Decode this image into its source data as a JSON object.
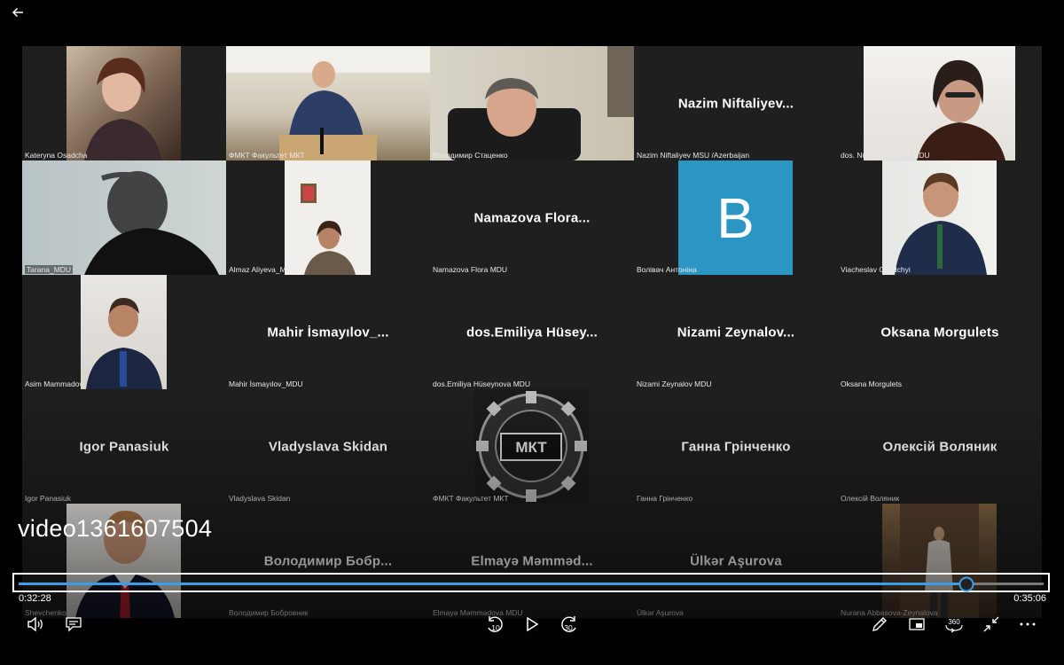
{
  "video": {
    "title": "video1361607504",
    "current_time": "0:32:28",
    "duration": "0:35:06",
    "progress_fraction": 0.925
  },
  "colors": {
    "accent": "#3a9ee8",
    "avatar_bg": "#2b95c4"
  },
  "icons": {
    "back": "arrow-left-icon",
    "volume": "volume-icon",
    "captions": "captions-icon",
    "skip_back": "skip-back-10-icon",
    "play": "play-icon",
    "skip_forward": "skip-forward-30-icon",
    "edit": "pen-icon",
    "miniplayer": "miniplayer-icon",
    "view360": "view-360-icon",
    "exit_fullscreen": "exit-fullscreen-icon",
    "more": "more-icon"
  },
  "controls": {
    "skip_back_label": "10",
    "skip_forward_label": "30",
    "view360_label": "360"
  },
  "participants": [
    {
      "name": "Kateryna Osadcha",
      "caption": "Kateryna Osadcha",
      "video": true
    },
    {
      "name": "ФМКТ Факультет МКТ",
      "caption": "ФМКТ Факультет МКТ",
      "video": true
    },
    {
      "name": "Володимир Стаценко",
      "caption": "Володимир Стаценко",
      "video": true
    },
    {
      "name": "Nazim  Niftaliyev...",
      "caption": "Nazim Niftaliyev MSU /Azerbaijan",
      "video": false
    },
    {
      "name": "dos. Nüşabə Qədimli MDU",
      "caption": "dos. Nüşabə Qədimli MDU",
      "video": true
    },
    {
      "name": "Tarana_MDU",
      "caption": "Tarana_MDU",
      "video": true
    },
    {
      "name": "Almaz Aliyeva_MDU",
      "caption": "Almaz Aliyeva_MDU",
      "video": true
    },
    {
      "name": "Namazova  Flora...",
      "caption": "Namazova Flora MDU",
      "video": false
    },
    {
      "name": "Волівач Антоніна",
      "caption": "Волівач Антоніна",
      "video": false,
      "avatar": "B"
    },
    {
      "name": "Viacheslav Osadchyi",
      "caption": "Viacheslav Osadchyi",
      "video": true
    },
    {
      "name": "Asim Mammadov",
      "caption": "Asim Mammadov",
      "video": true
    },
    {
      "name": "Mahir  İsmayılov_...",
      "caption": "Mahir İsmayılov_MDU",
      "video": false
    },
    {
      "name": "dos.Emiliya  Hüsey...",
      "caption": "dos.Emiliya Hüseynova MDU",
      "video": false
    },
    {
      "name": "Nizami  Zeynalov...",
      "caption": "Nizami Zeynalov MDU",
      "video": false
    },
    {
      "name": "Oksana Morgulets",
      "caption": "Oksana Morgulets",
      "video": false
    },
    {
      "name": "Igor Panasiuk",
      "caption": "Igor Panasiuk",
      "video": false
    },
    {
      "name": "Vladyslava Skidan",
      "caption": "Vladyslava Skidan",
      "video": false
    },
    {
      "name": "ФМКТ Факультет МКТ",
      "caption": "ФМКТ Факультет МКТ",
      "video": true,
      "logo": "МКТ"
    },
    {
      "name": "Ганна Грінченко",
      "caption": "Ганна Грінченко",
      "video": false
    },
    {
      "name": "Олексій Воляник",
      "caption": "Олексій Воляник",
      "video": false
    },
    {
      "name": "Shevchenko",
      "caption": "Shevchenko",
      "video": true
    },
    {
      "name": "Володимир  Бобр...",
      "caption": "Володимир Бобровник",
      "video": false
    },
    {
      "name": "Elmayə  Məmməd...",
      "caption": "Elmayə Məmmədova MDU",
      "video": false
    },
    {
      "name": "Ülkər Aşurova",
      "caption": "Ülkər Aşurova",
      "video": false
    },
    {
      "name": "Nurana Abbasova-Zeynalova",
      "caption": "Nurana Abbasova-Zeynalova",
      "video": true
    }
  ]
}
